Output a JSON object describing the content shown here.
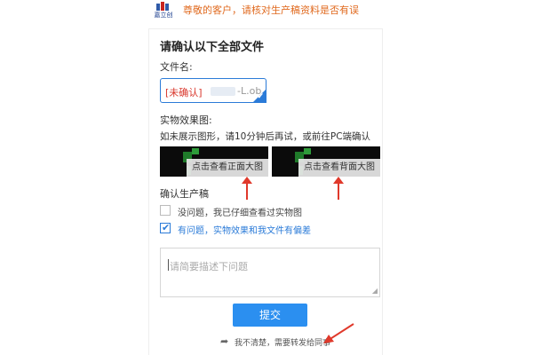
{
  "header": {
    "logo_text": "嘉立创",
    "notice": "尊敬的客户，请核对生产稿资料是否有误"
  },
  "confirm": {
    "title": "请确认以下全部文件",
    "file_label": "文件名:",
    "file_tag": "[未确认]",
    "file_name": "-L.ob..",
    "effect_label": "实物效果图:",
    "effect_hint": "如未展示图形，请10分钟后再试，或前往PC端确认",
    "front_button": "点击查看正面大图",
    "back_button": "点击查看背面大图",
    "confirm_label": "确认生产稿",
    "option_ok": "没问题，我已仔细查看过实物图",
    "option_problem": "有问题，实物效果和我文件有偏差",
    "option_problem_checked": true,
    "option_ok_checked": false,
    "textarea_placeholder": "请简要描述下问题",
    "submit_label": "提交",
    "forward_text": "我不清楚，需要转发给同事"
  },
  "colors": {
    "accent": "#2b8ff0",
    "notice": "#e06a1f",
    "warning": "#d9362b",
    "annotation_arrow": "#e0392b"
  },
  "icons": {
    "forward": "share-arrow-icon",
    "check": "checkmark-icon"
  }
}
